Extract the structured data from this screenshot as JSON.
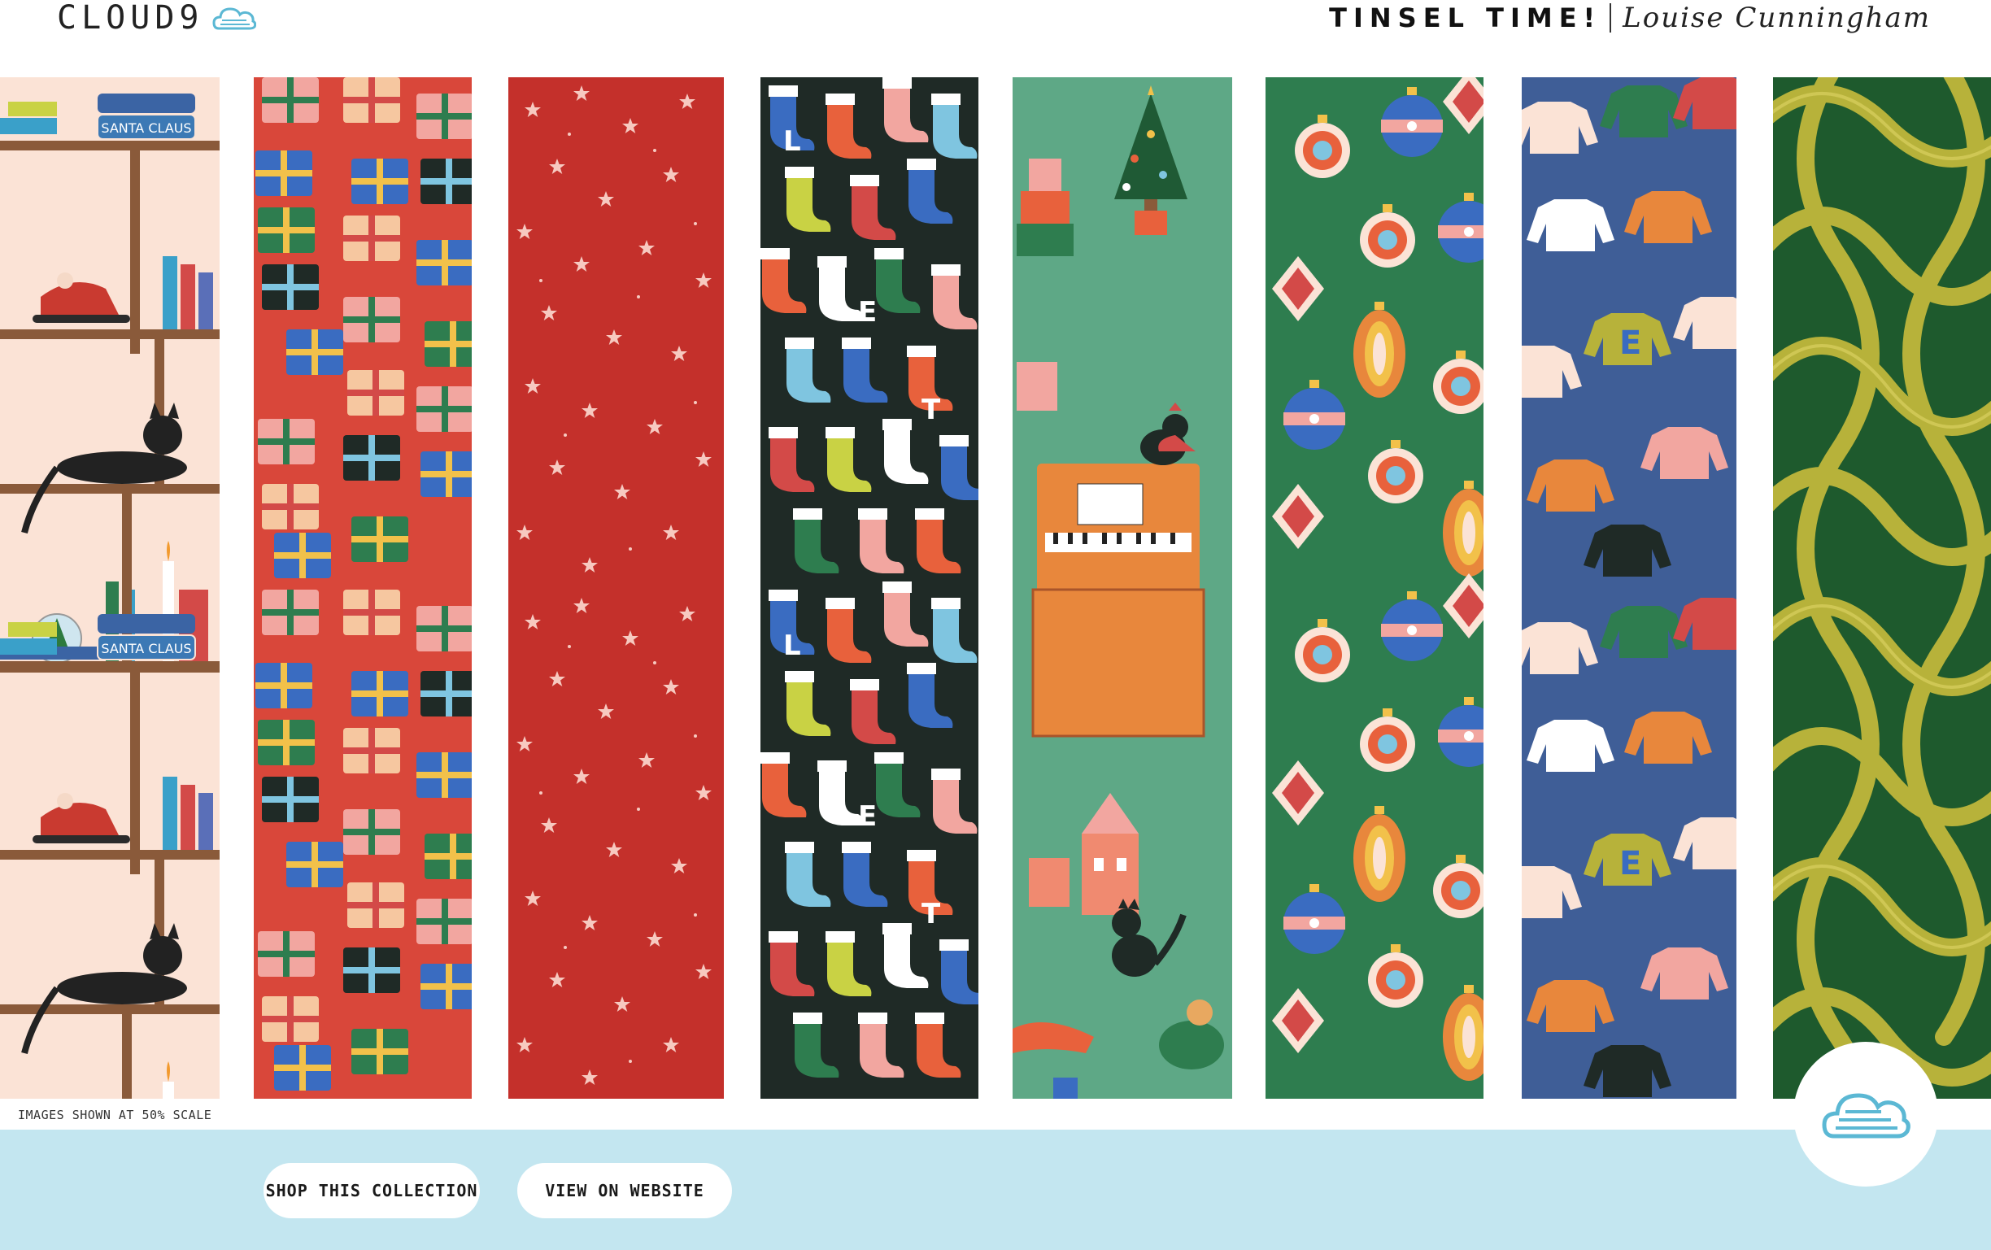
{
  "brand": {
    "logo_text": "CLOUD9",
    "logo_icon": "cloud-icon"
  },
  "collection": {
    "title": "TINSEL TIME!",
    "designer": "Louise Cunningham"
  },
  "swatches": [
    {
      "name": "bookshelf-cats",
      "label_1": "SANTA CLAUS",
      "label_2": "SANTA CLAUS",
      "background": "#fbe3d6"
    },
    {
      "name": "wrapped-presents",
      "background": "#d9473a"
    },
    {
      "name": "stars",
      "background": "#c4302b"
    },
    {
      "name": "stockings",
      "letters": [
        "L",
        "E",
        "T"
      ],
      "background": "#1f2a26"
    },
    {
      "name": "piano-tree-cat",
      "background": "#5ea886"
    },
    {
      "name": "ornaments",
      "background": "#2e7d4f"
    },
    {
      "name": "sweaters",
      "background": "#3f5e97"
    },
    {
      "name": "tinsel-loops",
      "background": "#1e5a2d",
      "accent": "#b7b23a"
    }
  ],
  "scale_note": "IMAGES SHOWN AT 50% SCALE",
  "buttons": {
    "shop": "SHOP THIS COLLECTION",
    "view": "VIEW ON WEBSITE"
  },
  "colors": {
    "footer": "#c3e6f0",
    "cloud_blue": "#5bb8d4"
  }
}
